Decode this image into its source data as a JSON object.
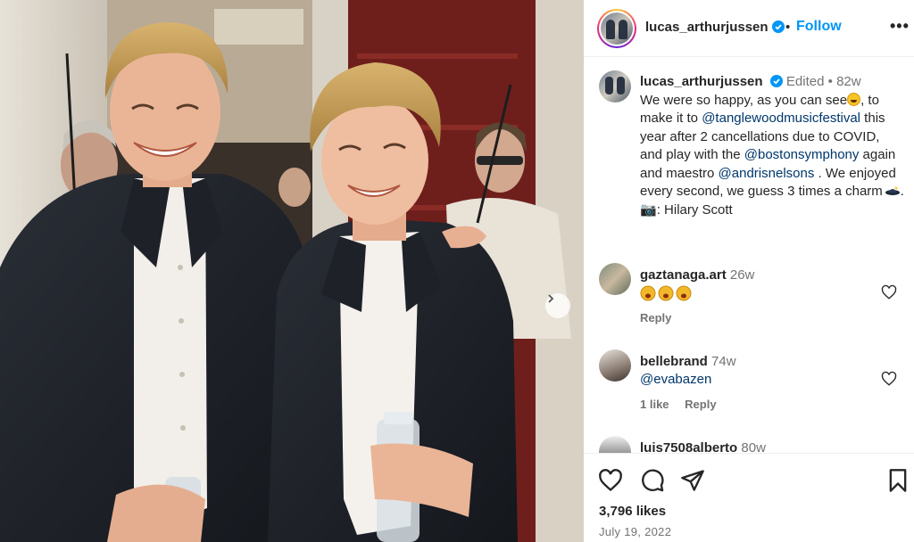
{
  "post": {
    "username": "lucas_arthurjussen",
    "separator": "•",
    "follow_label": "Follow",
    "more_label": "•••",
    "verified_icon": "verified-badge-icon",
    "accent_color": "#0095f6"
  },
  "caption": {
    "username": "lucas_arthurjussen",
    "edited_label": "Edited",
    "separator": "•",
    "time": "82w",
    "text_1": "We were so happy, as you can see",
    "text_2": ", to make it to ",
    "mention_1": "@tanglewoodmusicfestival",
    "text_3": " this year after 2 cancellations due to COVID, and play with the ",
    "mention_2": "@bostonsymphony",
    "text_4": " again and maestro ",
    "mention_3": "@andrisnelsons",
    "text_5": " . We enjoyed every second, we guess 3 times a charm",
    "text_6": ". ",
    "camera_emoji": "📷",
    "text_7": ": Hilary Scott"
  },
  "comments": [
    {
      "username": "gaztanaga.art",
      "time": "26w",
      "body": "",
      "emoji_count": "3",
      "reply_label": "Reply",
      "likes_label": ""
    },
    {
      "username": "bellebrand",
      "time": "74w",
      "body": "@evabazen",
      "reply_label": "Reply",
      "likes_label": "1 like"
    },
    {
      "username": "luis7508alberto",
      "time": "80w"
    }
  ],
  "stats": {
    "likes": "3,796 likes",
    "date": "July 19, 2022"
  }
}
